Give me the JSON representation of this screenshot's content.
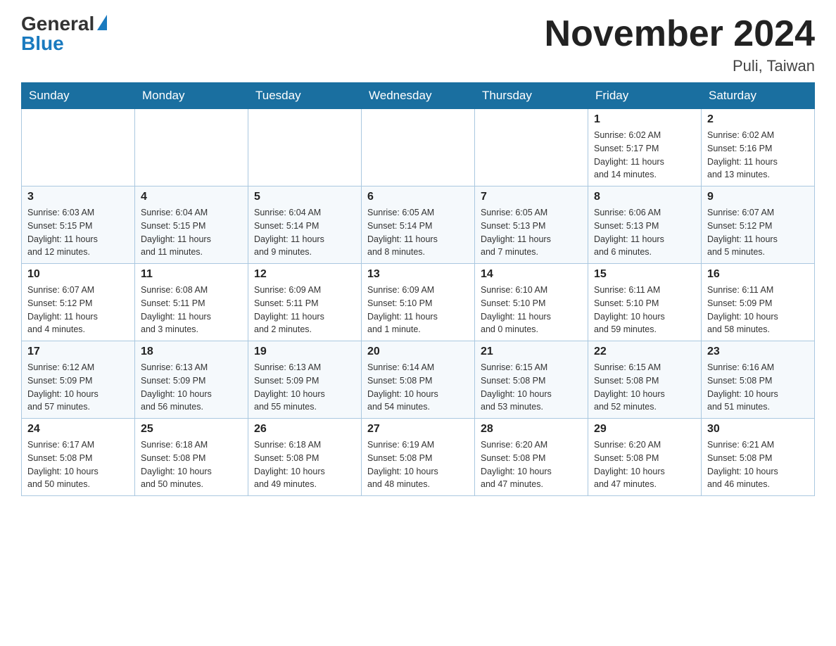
{
  "logo": {
    "general": "General",
    "blue": "Blue"
  },
  "header": {
    "title": "November 2024",
    "location": "Puli, Taiwan"
  },
  "weekdays": [
    "Sunday",
    "Monday",
    "Tuesday",
    "Wednesday",
    "Thursday",
    "Friday",
    "Saturday"
  ],
  "weeks": [
    [
      {
        "day": "",
        "info": ""
      },
      {
        "day": "",
        "info": ""
      },
      {
        "day": "",
        "info": ""
      },
      {
        "day": "",
        "info": ""
      },
      {
        "day": "",
        "info": ""
      },
      {
        "day": "1",
        "info": "Sunrise: 6:02 AM\nSunset: 5:17 PM\nDaylight: 11 hours\nand 14 minutes."
      },
      {
        "day": "2",
        "info": "Sunrise: 6:02 AM\nSunset: 5:16 PM\nDaylight: 11 hours\nand 13 minutes."
      }
    ],
    [
      {
        "day": "3",
        "info": "Sunrise: 6:03 AM\nSunset: 5:15 PM\nDaylight: 11 hours\nand 12 minutes."
      },
      {
        "day": "4",
        "info": "Sunrise: 6:04 AM\nSunset: 5:15 PM\nDaylight: 11 hours\nand 11 minutes."
      },
      {
        "day": "5",
        "info": "Sunrise: 6:04 AM\nSunset: 5:14 PM\nDaylight: 11 hours\nand 9 minutes."
      },
      {
        "day": "6",
        "info": "Sunrise: 6:05 AM\nSunset: 5:14 PM\nDaylight: 11 hours\nand 8 minutes."
      },
      {
        "day": "7",
        "info": "Sunrise: 6:05 AM\nSunset: 5:13 PM\nDaylight: 11 hours\nand 7 minutes."
      },
      {
        "day": "8",
        "info": "Sunrise: 6:06 AM\nSunset: 5:13 PM\nDaylight: 11 hours\nand 6 minutes."
      },
      {
        "day": "9",
        "info": "Sunrise: 6:07 AM\nSunset: 5:12 PM\nDaylight: 11 hours\nand 5 minutes."
      }
    ],
    [
      {
        "day": "10",
        "info": "Sunrise: 6:07 AM\nSunset: 5:12 PM\nDaylight: 11 hours\nand 4 minutes."
      },
      {
        "day": "11",
        "info": "Sunrise: 6:08 AM\nSunset: 5:11 PM\nDaylight: 11 hours\nand 3 minutes."
      },
      {
        "day": "12",
        "info": "Sunrise: 6:09 AM\nSunset: 5:11 PM\nDaylight: 11 hours\nand 2 minutes."
      },
      {
        "day": "13",
        "info": "Sunrise: 6:09 AM\nSunset: 5:10 PM\nDaylight: 11 hours\nand 1 minute."
      },
      {
        "day": "14",
        "info": "Sunrise: 6:10 AM\nSunset: 5:10 PM\nDaylight: 11 hours\nand 0 minutes."
      },
      {
        "day": "15",
        "info": "Sunrise: 6:11 AM\nSunset: 5:10 PM\nDaylight: 10 hours\nand 59 minutes."
      },
      {
        "day": "16",
        "info": "Sunrise: 6:11 AM\nSunset: 5:09 PM\nDaylight: 10 hours\nand 58 minutes."
      }
    ],
    [
      {
        "day": "17",
        "info": "Sunrise: 6:12 AM\nSunset: 5:09 PM\nDaylight: 10 hours\nand 57 minutes."
      },
      {
        "day": "18",
        "info": "Sunrise: 6:13 AM\nSunset: 5:09 PM\nDaylight: 10 hours\nand 56 minutes."
      },
      {
        "day": "19",
        "info": "Sunrise: 6:13 AM\nSunset: 5:09 PM\nDaylight: 10 hours\nand 55 minutes."
      },
      {
        "day": "20",
        "info": "Sunrise: 6:14 AM\nSunset: 5:08 PM\nDaylight: 10 hours\nand 54 minutes."
      },
      {
        "day": "21",
        "info": "Sunrise: 6:15 AM\nSunset: 5:08 PM\nDaylight: 10 hours\nand 53 minutes."
      },
      {
        "day": "22",
        "info": "Sunrise: 6:15 AM\nSunset: 5:08 PM\nDaylight: 10 hours\nand 52 minutes."
      },
      {
        "day": "23",
        "info": "Sunrise: 6:16 AM\nSunset: 5:08 PM\nDaylight: 10 hours\nand 51 minutes."
      }
    ],
    [
      {
        "day": "24",
        "info": "Sunrise: 6:17 AM\nSunset: 5:08 PM\nDaylight: 10 hours\nand 50 minutes."
      },
      {
        "day": "25",
        "info": "Sunrise: 6:18 AM\nSunset: 5:08 PM\nDaylight: 10 hours\nand 50 minutes."
      },
      {
        "day": "26",
        "info": "Sunrise: 6:18 AM\nSunset: 5:08 PM\nDaylight: 10 hours\nand 49 minutes."
      },
      {
        "day": "27",
        "info": "Sunrise: 6:19 AM\nSunset: 5:08 PM\nDaylight: 10 hours\nand 48 minutes."
      },
      {
        "day": "28",
        "info": "Sunrise: 6:20 AM\nSunset: 5:08 PM\nDaylight: 10 hours\nand 47 minutes."
      },
      {
        "day": "29",
        "info": "Sunrise: 6:20 AM\nSunset: 5:08 PM\nDaylight: 10 hours\nand 47 minutes."
      },
      {
        "day": "30",
        "info": "Sunrise: 6:21 AM\nSunset: 5:08 PM\nDaylight: 10 hours\nand 46 minutes."
      }
    ]
  ]
}
